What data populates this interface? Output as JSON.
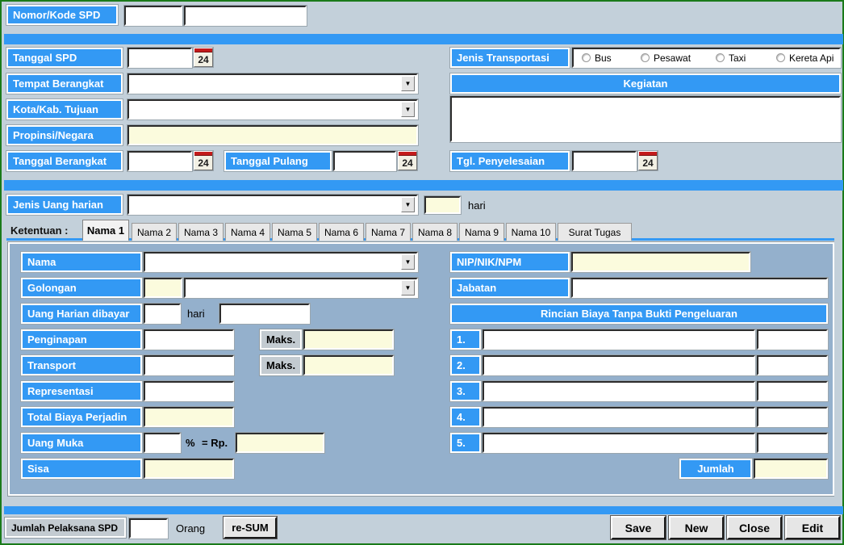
{
  "header": {
    "nomor_label": "Nomor/Kode SPD",
    "nomor_value": "",
    "kode_value": ""
  },
  "trip": {
    "tanggal_spd_label": "Tanggal SPD",
    "tanggal_spd_value": "",
    "tempat_berangkat_label": "Tempat Berangkat",
    "tempat_berangkat_value": "",
    "kota_tujuan_label": "Kota/Kab. Tujuan",
    "kota_tujuan_value": "",
    "propinsi_label": "Propinsi/Negara",
    "propinsi_value": "",
    "tanggal_berangkat_label": "Tanggal Berangkat",
    "tanggal_berangkat_value": "",
    "tanggal_pulang_label": "Tanggal Pulang",
    "tanggal_pulang_value": "",
    "calendar_icon_day": "24"
  },
  "transport": {
    "label": "Jenis Transportasi",
    "options": [
      "Bus",
      "Pesawat",
      "Taxi",
      "Kereta Api"
    ],
    "selected": ""
  },
  "kegiatan": {
    "title": "Kegiatan",
    "value": ""
  },
  "penyelesaian": {
    "label": "Tgl. Penyelesaian",
    "value": ""
  },
  "uang_harian": {
    "label": "Jenis Uang harian",
    "value": "",
    "days_value": "",
    "days_unit": "hari"
  },
  "tabs": {
    "prefix_label": "Ketentuan :",
    "items": [
      "Nama 1",
      "Nama 2",
      "Nama 3",
      "Nama 4",
      "Nama 5",
      "Nama 6",
      "Nama 7",
      "Nama 8",
      "Nama 9",
      "Nama 10",
      "Surat Tugas"
    ],
    "active_index": 0
  },
  "person_left": {
    "nama_label": "Nama",
    "nama_value": "",
    "golongan_label": "Golongan",
    "golongan_code": "",
    "golongan_value": "",
    "uang_harian_dibayar_label": "Uang Harian dibayar",
    "uang_harian_dibayar_days": "",
    "uang_harian_dibayar_unit": "hari",
    "uang_harian_dibayar_amount": "",
    "penginapan_label": "Penginapan",
    "penginapan_value": "",
    "penginapan_maks_label": "Maks.",
    "penginapan_maks_value": "",
    "transport_label": "Transport",
    "transport_value": "",
    "transport_maks_label": "Maks.",
    "transport_maks_value": "",
    "representasi_label": "Representasi",
    "representasi_value": "",
    "total_label": "Total Biaya Perjadin",
    "total_value": "",
    "uang_muka_label": "Uang Muka",
    "uang_muka_percent": "",
    "uang_muka_percent_sign": "%",
    "uang_muka_rp_label": "= Rp.",
    "uang_muka_value": "",
    "sisa_label": "Sisa",
    "sisa_value": ""
  },
  "person_right": {
    "nip_label": "NIP/NIK/NPM",
    "nip_value": "",
    "jabatan_label": "Jabatan",
    "jabatan_value": "",
    "rincian_title": "Rincian Biaya Tanpa Bukti Pengeluaran",
    "rows": [
      {
        "no": "1.",
        "desc": "",
        "amount": ""
      },
      {
        "no": "2.",
        "desc": "",
        "amount": ""
      },
      {
        "no": "3.",
        "desc": "",
        "amount": ""
      },
      {
        "no": "4.",
        "desc": "",
        "amount": ""
      },
      {
        "no": "5.",
        "desc": "",
        "amount": ""
      }
    ],
    "jumlah_label": "Jumlah",
    "jumlah_value": ""
  },
  "footer": {
    "pelaksana_label": "Jumlah Pelaksana SPD",
    "pelaksana_value": "",
    "pelaksana_unit": "Orang",
    "resum_label": "re-SUM",
    "save_label": "Save",
    "new_label": "New",
    "close_label": "Close",
    "edit_label": "Edit"
  }
}
